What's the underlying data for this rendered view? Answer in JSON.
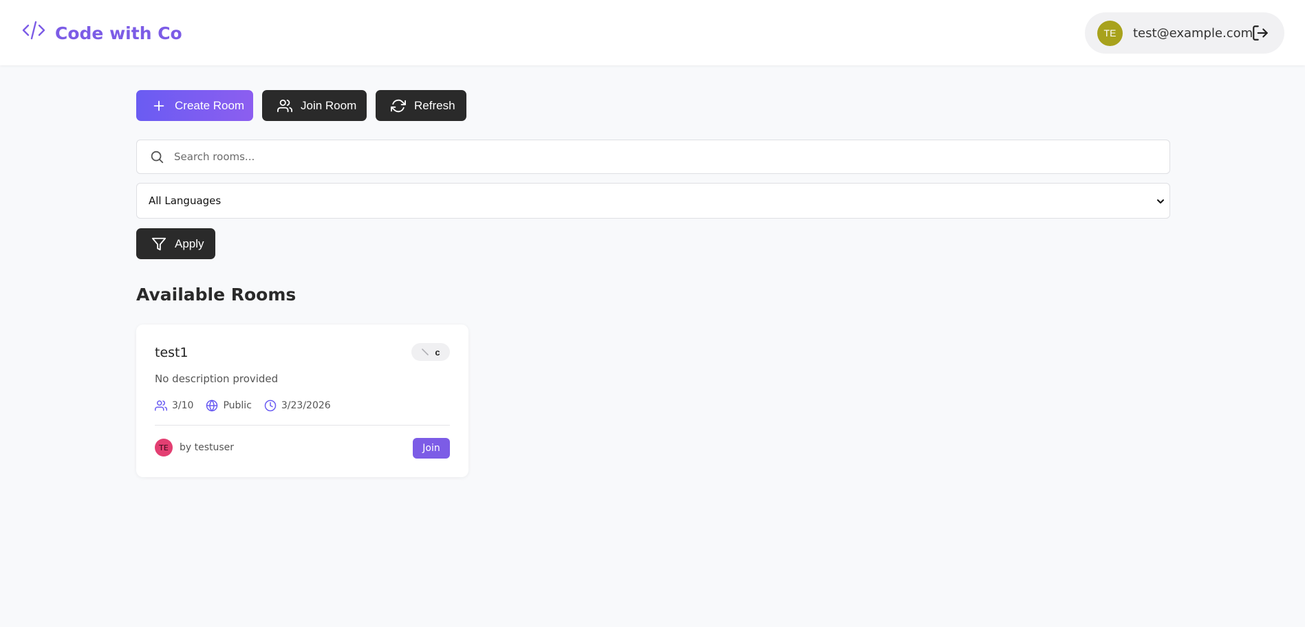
{
  "header": {
    "brand": "Code with Co",
    "user": {
      "initials": "TE",
      "email": "test@example.com"
    }
  },
  "actions": {
    "create_label": "Create Room",
    "join_label": "Join Room",
    "refresh_label": "Refresh"
  },
  "search": {
    "placeholder": "Search rooms...",
    "value": ""
  },
  "filter": {
    "selected": "All Languages",
    "apply_label": "Apply"
  },
  "rooms_section": {
    "title": "Available Rooms",
    "rooms": [
      {
        "name": "test1",
        "language": "c",
        "description": "No description provided",
        "participants": "3/10",
        "visibility": "Public",
        "date": "3/23/2026",
        "owner_initials": "TE",
        "owner": "by testuser",
        "join_label": "Join"
      }
    ]
  },
  "colors": {
    "brand": "#7c5ce6",
    "dark_button": "#2a2a2a",
    "user_avatar": "#a8a21c",
    "owner_avatar": "#e33f72",
    "background": "#f8f9fb"
  }
}
